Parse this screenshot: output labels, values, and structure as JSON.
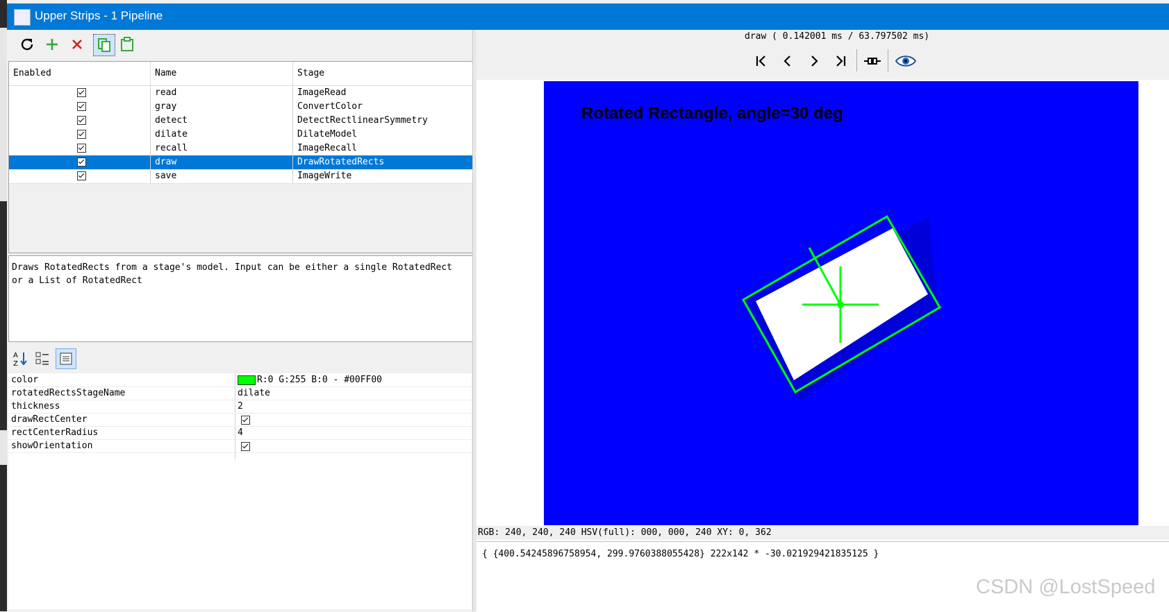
{
  "window": {
    "title": "Upper Strips - 1 Pipeline"
  },
  "toolbar": {
    "refresh_icon": "refresh-icon",
    "add_icon": "plus-icon",
    "remove_icon": "close-icon",
    "copy_icon": "copy-icon",
    "paste_icon": "paste-icon"
  },
  "table": {
    "headers": [
      "Enabled",
      "Name",
      "Stage"
    ],
    "rows": [
      {
        "enabled": true,
        "name": "read",
        "stage": "ImageRead"
      },
      {
        "enabled": true,
        "name": "gray",
        "stage": "ConvertColor"
      },
      {
        "enabled": true,
        "name": "detect",
        "stage": "DetectRectlinearSymmetry"
      },
      {
        "enabled": true,
        "name": "dilate",
        "stage": "DilateModel"
      },
      {
        "enabled": true,
        "name": "recall",
        "stage": "ImageRecall"
      },
      {
        "enabled": true,
        "name": "draw",
        "stage": "DrawRotatedRects",
        "selected": true
      },
      {
        "enabled": true,
        "name": "save",
        "stage": "ImageWrite"
      }
    ]
  },
  "description": "Draws RotatedRects from a stage's model. Input can be either a single RotatedRect\nor a List of RotatedRect",
  "properties": [
    {
      "name": "color",
      "value": "R:0 G:255 B:0 - #00FF00",
      "swatch": "#00ff00"
    },
    {
      "name": "rotatedRectsStageName",
      "value": "dilate"
    },
    {
      "name": "thickness",
      "value": "2"
    },
    {
      "name": "drawRectCenter",
      "checked": true
    },
    {
      "name": "rectCenterRadius",
      "value": "4"
    },
    {
      "name": "showOrientation",
      "checked": true
    }
  ],
  "viewer": {
    "timing": "draw ( 0.142001 ms / 63.797502 ms)",
    "image_caption": "Rotated Rectangle, angle=30 deg",
    "pixel_info": "RGB: 240, 240, 240 HSV(full): 000, 000, 240 XY: 0, 362",
    "model_text": "{ {400.54245896758954, 299.9760388055428} 222x142 * -30.021929421835125 }"
  },
  "watermark": "CSDN @LostSpeed",
  "colors": {
    "titlebar": "#0078d7",
    "selection": "#0078d7",
    "image_bg": "#0000ff",
    "rect": "#00ff00"
  }
}
